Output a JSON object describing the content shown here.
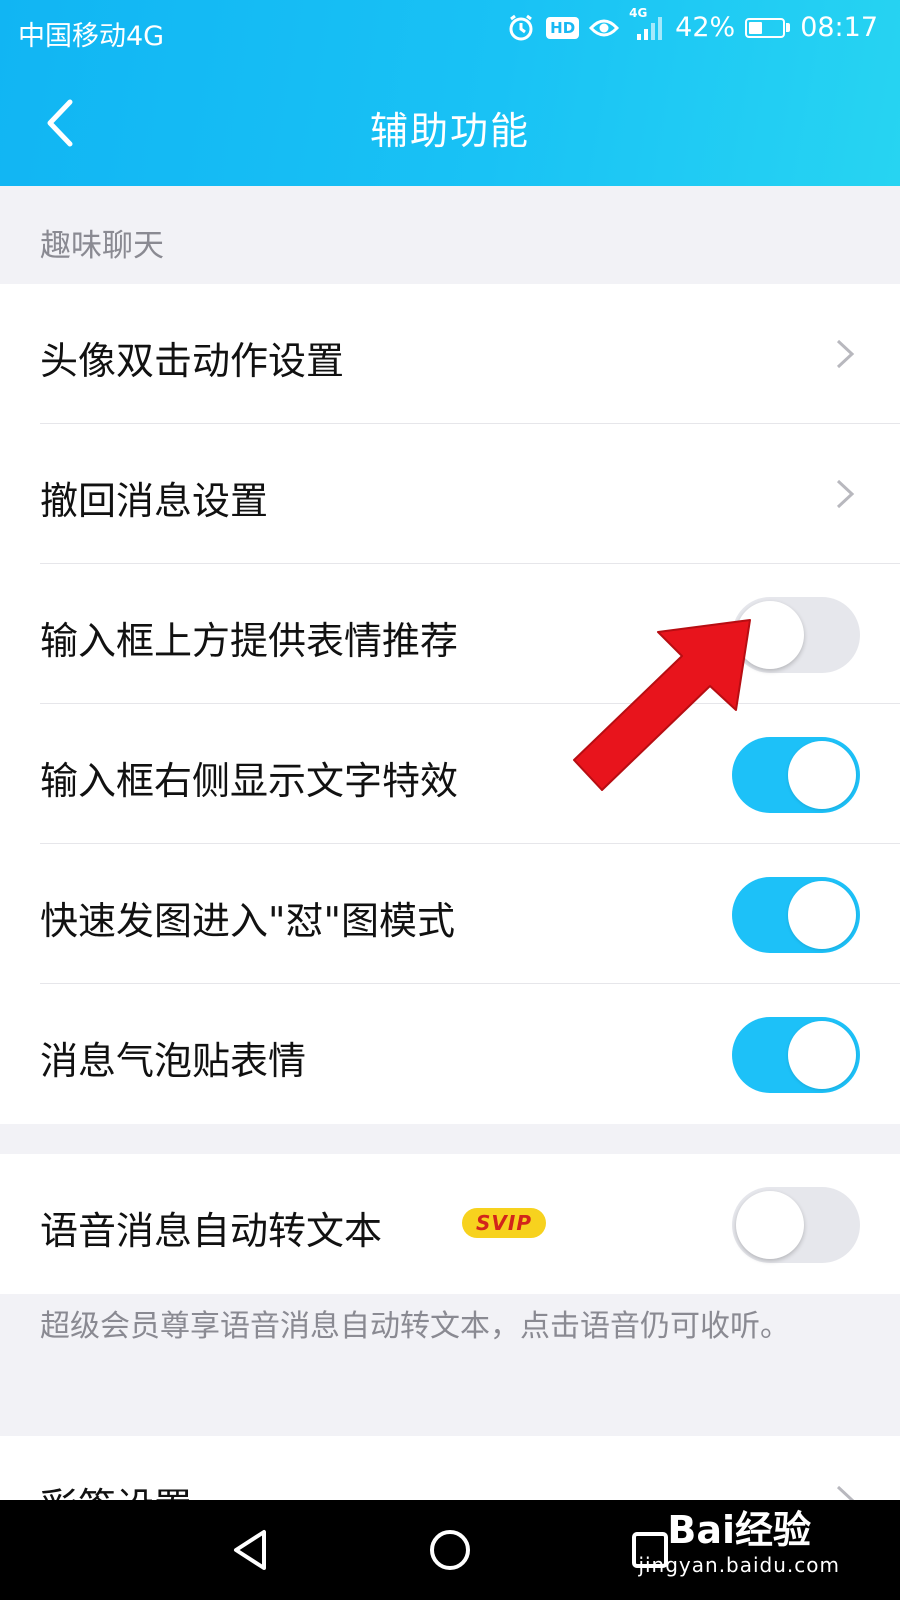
{
  "status_bar": {
    "carrier": "中国移动4G",
    "hd_label": "HD",
    "network_label": "4G",
    "battery_percent": "42%",
    "battery_level": 0.42,
    "time": "08:17",
    "icons": [
      "alarm-icon",
      "hd-icon",
      "eye-icon",
      "signal-icon",
      "battery-icon"
    ]
  },
  "nav": {
    "back_icon": "back-chevron-icon",
    "title": "辅助功能"
  },
  "section_fun_chat": {
    "header": "趣味聊天",
    "items": [
      {
        "label": "头像双击动作设置",
        "type": "link"
      },
      {
        "label": "撤回消息设置",
        "type": "link"
      },
      {
        "label": "输入框上方提供表情推荐",
        "type": "toggle",
        "on": false
      },
      {
        "label": "输入框右侧显示文字特效",
        "type": "toggle",
        "on": true
      },
      {
        "label": "快速发图进入\"怼\"图模式",
        "type": "toggle",
        "on": true
      },
      {
        "label": "消息气泡贴表情",
        "type": "toggle",
        "on": true
      }
    ]
  },
  "section_voice": {
    "item": {
      "label": "语音消息自动转文本",
      "badge": "SVIP",
      "type": "toggle",
      "on": false
    },
    "footnote": "超级会员尊享语音消息自动转文本，点击语音仍可收听。"
  },
  "section_bubbles": {
    "item": {
      "label": "彩签设置",
      "type": "link"
    }
  },
  "colors": {
    "header_gradient_start": "#11b5f3",
    "header_gradient_end": "#27d4f2",
    "toggle_on": "#1dc1f8",
    "toggle_off": "#e6e7ec",
    "svip_bg": "#f7d21e",
    "svip_text": "#d2251b",
    "annotation_arrow": "#e8141c"
  },
  "system_nav": {
    "icons": [
      "nav-back-triangle-icon",
      "nav-home-circle-icon",
      "nav-recent-square-icon"
    ]
  },
  "watermark": {
    "brand": "Bai经验",
    "url": "jingyan.baidu.com"
  }
}
